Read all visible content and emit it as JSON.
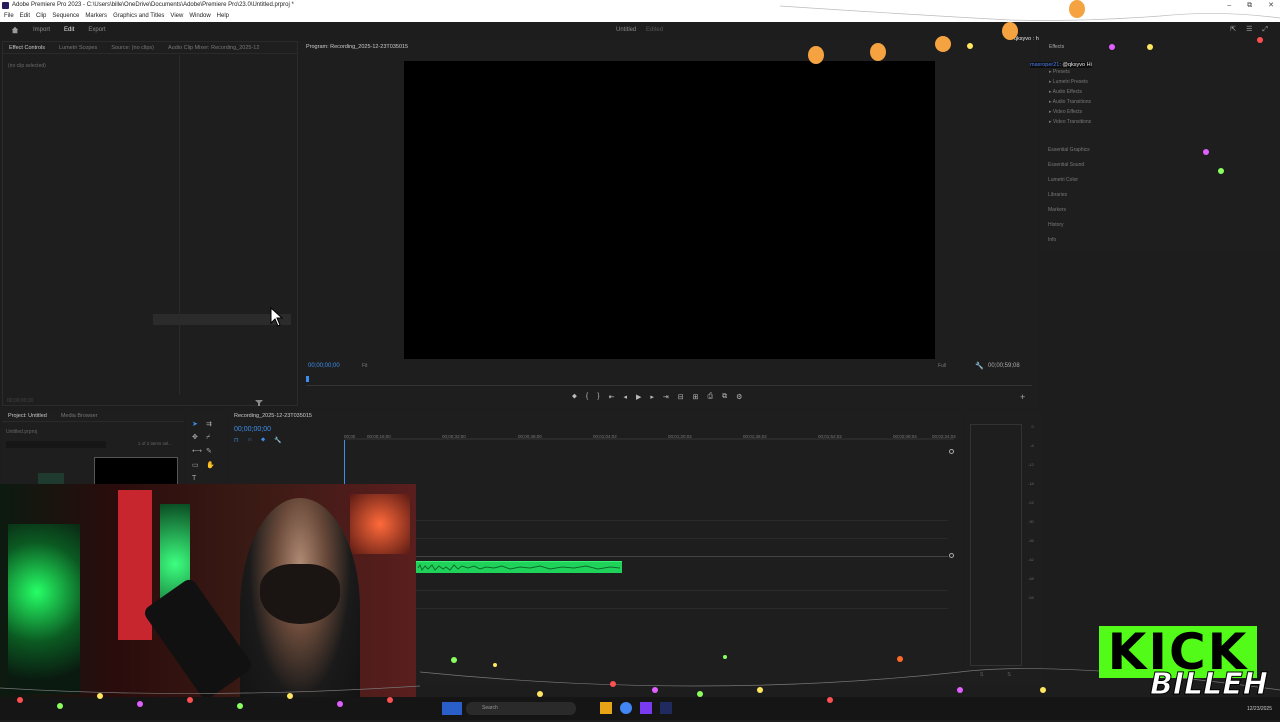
{
  "window": {
    "title": "Adobe Premiere Pro 2023 - C:\\Users\\bille\\OneDrive\\Documents\\Adobe\\Premiere Pro\\23.0\\Untitled.prproj *",
    "controls": [
      "–",
      "⧉",
      "✕"
    ]
  },
  "menu": [
    "File",
    "Edit",
    "Clip",
    "Sequence",
    "Markers",
    "Graphics and Titles",
    "View",
    "Window",
    "Help"
  ],
  "workspace": {
    "tabs": [
      "Import",
      "Edit",
      "Export"
    ],
    "active": "Edit",
    "project_name": "Untitled",
    "project_status": "Edited"
  },
  "effect_controls": {
    "tabs": [
      "Effect Controls",
      "Lumetri Scopes",
      "Source: (no clips)",
      "Audio Clip Mixer: Recording_2025-12"
    ],
    "no_clip": "(no clip selected)",
    "timecode": "00;00;00;00"
  },
  "program": {
    "tab": "Program: Recording_2025-12-23T035015",
    "timecode": "00;00;00;00",
    "fit": "Fit",
    "quality": "Full",
    "duration": "00;00;59;08"
  },
  "effects": {
    "tab": "Effects",
    "folders": [
      "Presets",
      "Lumetri Presets",
      "Audio Effects",
      "Audio Transitions",
      "Video Effects",
      "Video Transitions"
    ],
    "panels": [
      "Essential Graphics",
      "Essential Sound",
      "Lumetri Color",
      "Libraries",
      "Markers",
      "History",
      "Info"
    ]
  },
  "chat": {
    "line1": "qksyvo : h",
    "line2_user": "maxroper21",
    "line2_msg": ": @qksyvo Hi"
  },
  "project": {
    "tabs": [
      "Project: Untitled",
      "Media Browser"
    ],
    "file": "Untitled.prproj",
    "count": "1 of 2 items sel..."
  },
  "timeline": {
    "tab": "Recording_2025-12-23T035015",
    "timecode": "00;00;00;00",
    "ruler": [
      "00;00",
      "00;00;16;00",
      "00;00;32;00",
      "00;00;48;00",
      "00;01;04;02",
      "00;01;20;02",
      "00;01;36;02",
      "00;01;52;02",
      "00;02;08;04",
      "00;02;24;04"
    ]
  },
  "meter": {
    "scale": [
      "0",
      "-6",
      "-12",
      "-18",
      "-24",
      "-30",
      "-36",
      "-42",
      "-48",
      "-54"
    ],
    "footer": [
      "S",
      "S"
    ]
  },
  "overlay": {
    "kick": "KICK",
    "name": "BILLEH",
    "date": "12/23/2025"
  },
  "taskbar": {
    "search": "Search"
  },
  "colors": {
    "timecode": "#3d8eea",
    "audio_clip": "#1fd35a",
    "kick_green": "#53fc18"
  }
}
